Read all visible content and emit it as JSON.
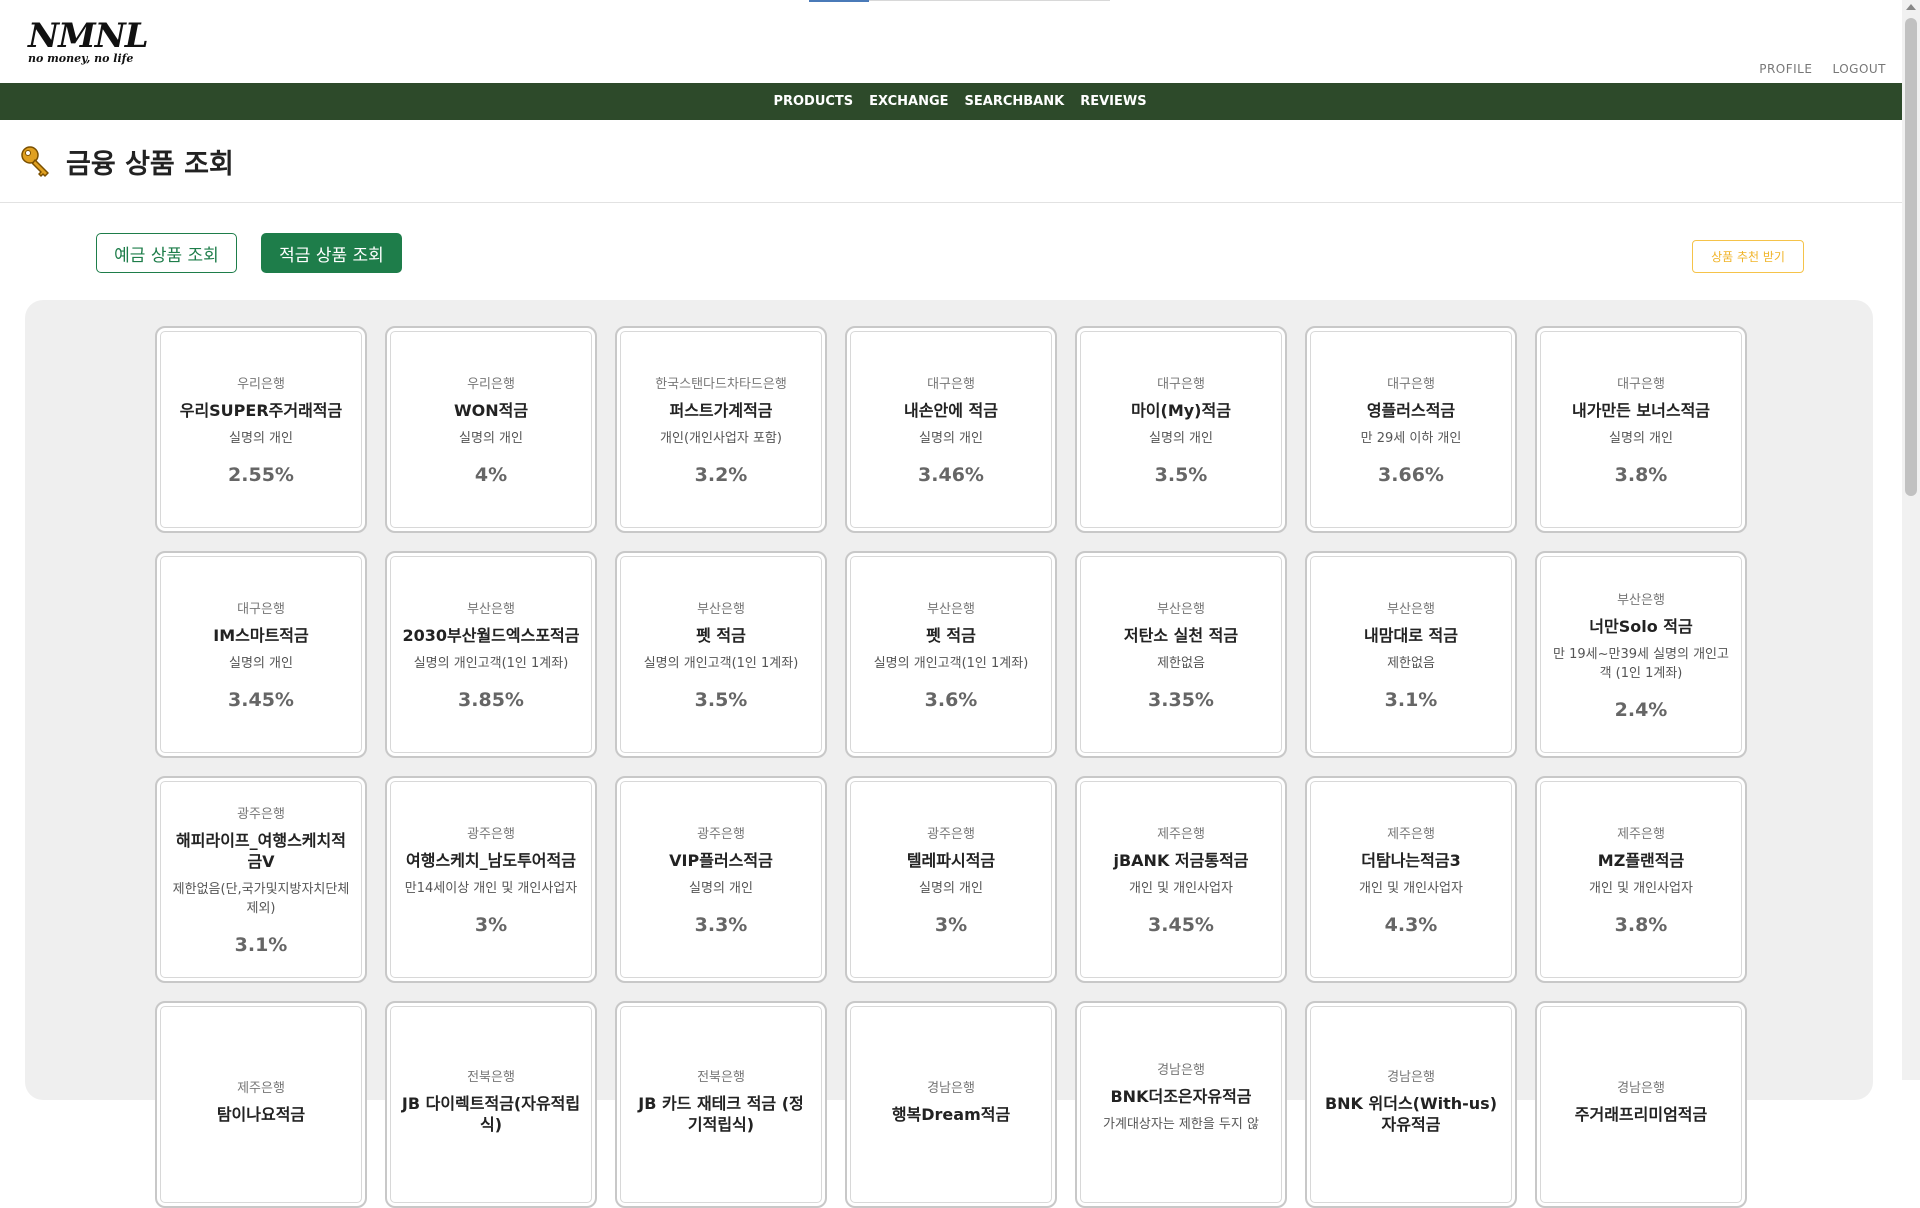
{
  "header": {
    "logo_main": "NMNL",
    "logo_sub": "no money, no life",
    "profile_label": "PROFILE",
    "logout_label": "LOGOUT"
  },
  "nav": {
    "items": [
      {
        "label": "PRODUCTS"
      },
      {
        "label": "EXCHANGE"
      },
      {
        "label": "SEARCHBANK"
      },
      {
        "label": "REVIEWS"
      }
    ]
  },
  "page": {
    "title": "금융 상품 조회",
    "deposit_tab_label": "예금 상품 조회",
    "savings_tab_label": "적금 상품 조회",
    "recommend_label": "상품 추천 받기"
  },
  "colors": {
    "navbar": "#2d4a2a",
    "accent_green": "#1e7d4a",
    "recommend_yellow": "#f0b429"
  },
  "products": [
    {
      "bank": "우리은행",
      "name": "우리SUPER주거래적금",
      "target": "실명의 개인",
      "rate": "2.55%"
    },
    {
      "bank": "우리은행",
      "name": "WON적금",
      "target": "실명의 개인",
      "rate": "4%"
    },
    {
      "bank": "한국스탠다드차타드은행",
      "name": "퍼스트가계적금",
      "target": "개인(개인사업자 포함)",
      "rate": "3.2%"
    },
    {
      "bank": "대구은행",
      "name": "내손안에 적금",
      "target": "실명의 개인",
      "rate": "3.46%"
    },
    {
      "bank": "대구은행",
      "name": "마이(My)적금",
      "target": "실명의 개인",
      "rate": "3.5%"
    },
    {
      "bank": "대구은행",
      "name": "영플러스적금",
      "target": "만 29세 이하 개인",
      "rate": "3.66%"
    },
    {
      "bank": "대구은행",
      "name": "내가만든 보너스적금",
      "target": "실명의 개인",
      "rate": "3.8%"
    },
    {
      "bank": "대구은행",
      "name": "IM스마트적금",
      "target": "실명의 개인",
      "rate": "3.45%"
    },
    {
      "bank": "부산은행",
      "name": "2030부산월드엑스포적금",
      "target": "실명의 개인고객(1인 1계좌)",
      "rate": "3.85%"
    },
    {
      "bank": "부산은행",
      "name": "펫 적금",
      "target": "실명의 개인고객(1인 1계좌)",
      "rate": "3.5%"
    },
    {
      "bank": "부산은행",
      "name": "펫 적금",
      "target": "실명의 개인고객(1인 1계좌)",
      "rate": "3.6%"
    },
    {
      "bank": "부산은행",
      "name": "저탄소 실천 적금",
      "target": "제한없음",
      "rate": "3.35%"
    },
    {
      "bank": "부산은행",
      "name": "내맘대로 적금",
      "target": "제한없음",
      "rate": "3.1%"
    },
    {
      "bank": "부산은행",
      "name": "너만Solo 적금",
      "target": "만 19세~만39세 실명의 개인고객 (1인 1계좌)",
      "rate": "2.4%"
    },
    {
      "bank": "광주은행",
      "name": "해피라이프_여행스케치적금V",
      "target": "제한없음(단,국가및지방자치단체제외)",
      "rate": "3.1%"
    },
    {
      "bank": "광주은행",
      "name": "여행스케치_남도투어적금",
      "target": "만14세이상 개인 및 개인사업자",
      "rate": "3%"
    },
    {
      "bank": "광주은행",
      "name": "VIP플러스적금",
      "target": "실명의 개인",
      "rate": "3.3%"
    },
    {
      "bank": "광주은행",
      "name": "텔레파시적금",
      "target": "실명의 개인",
      "rate": "3%"
    },
    {
      "bank": "제주은행",
      "name": "jBANK 저금통적금",
      "target": "개인 및 개인사업자",
      "rate": "3.45%"
    },
    {
      "bank": "제주은행",
      "name": "더탐나는적금3",
      "target": "개인 및 개인사업자",
      "rate": "4.3%"
    },
    {
      "bank": "제주은행",
      "name": "MZ플랜적금",
      "target": "개인 및 개인사업자",
      "rate": "3.8%"
    },
    {
      "bank": "제주은행",
      "name": "탐이나요적금",
      "target": "",
      "rate": ""
    },
    {
      "bank": "전북은행",
      "name": "JB 다이렉트적금(자유적립식)",
      "target": "",
      "rate": ""
    },
    {
      "bank": "전북은행",
      "name": "JB 카드 재테크 적금 (정기적립식)",
      "target": "",
      "rate": ""
    },
    {
      "bank": "경남은행",
      "name": "행복Dream적금",
      "target": "",
      "rate": ""
    },
    {
      "bank": "경남은행",
      "name": "BNK더조은자유적금",
      "target": "가계대상자는 제한을 두지 않",
      "rate": ""
    },
    {
      "bank": "경남은행",
      "name": "BNK 위더스(With-us)자유적금",
      "target": "",
      "rate": ""
    },
    {
      "bank": "경남은행",
      "name": "주거래프리미엄적금",
      "target": "",
      "rate": ""
    }
  ]
}
